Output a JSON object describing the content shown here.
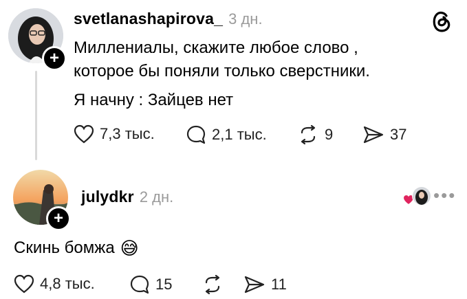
{
  "post": {
    "username": "svetlanashapirova_",
    "time": "3 дн.",
    "text_line1": "Миллениалы, скажите любое слово ,",
    "text_line2": "которое бы поняли только сверстники.",
    "text_line3": "Я начну : Зайцев нет",
    "likes": "7,3 тыс.",
    "replies": "2,1 тыс.",
    "reposts": "9",
    "shares": "37",
    "app_icon": "threads-icon"
  },
  "reply": {
    "username": "julydkr",
    "time": "2 дн.",
    "text": "Скинь бомжа",
    "emoji": "😅",
    "likes": "4,8 тыс.",
    "replies": "15",
    "shares": "11"
  },
  "colors": {
    "heart_liked": "#e0245e",
    "muted": "#9a9a9a",
    "thread_line": "#d9d9d9"
  }
}
